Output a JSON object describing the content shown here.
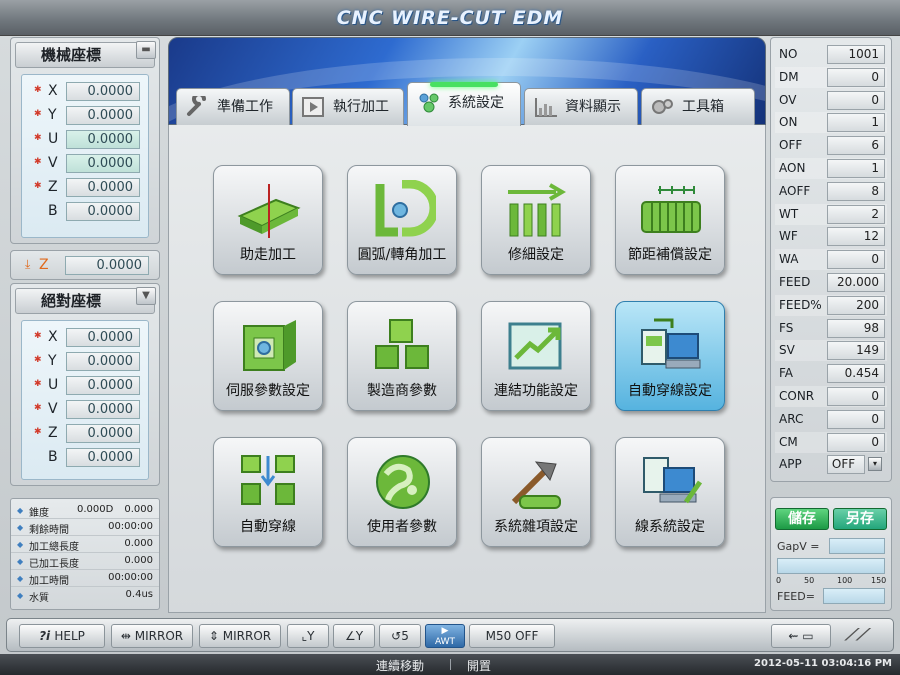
{
  "title": "CNC WIRE-CUT EDM",
  "machine_coords": {
    "title": "機械座標",
    "rows": [
      {
        "axis": "X",
        "value": "0.0000"
      },
      {
        "axis": "Y",
        "value": "0.0000"
      },
      {
        "axis": "U",
        "value": "0.0000"
      },
      {
        "axis": "V",
        "value": "0.0000"
      },
      {
        "axis": "Z",
        "value": "0.0000"
      },
      {
        "axis": "B",
        "value": "0.0000"
      }
    ]
  },
  "z_reading": {
    "label": "Z",
    "value": "0.0000"
  },
  "absolute_coords": {
    "title": "絕對座標",
    "rows": [
      {
        "axis": "X",
        "value": "0.0000"
      },
      {
        "axis": "Y",
        "value": "0.0000"
      },
      {
        "axis": "U",
        "value": "0.0000"
      },
      {
        "axis": "V",
        "value": "0.0000"
      },
      {
        "axis": "Z",
        "value": "0.0000"
      },
      {
        "axis": "B",
        "value": "0.0000"
      }
    ]
  },
  "status": [
    {
      "label": "錐度",
      "mid": "0.000D",
      "value": "0.000"
    },
    {
      "label": "剩餘時間",
      "mid": "",
      "value": "00:00:00"
    },
    {
      "label": "加工總長度",
      "mid": "",
      "value": "0.000"
    },
    {
      "label": "已加工長度",
      "mid": "",
      "value": "0.000"
    },
    {
      "label": "加工時間",
      "mid": "",
      "value": "00:00:00"
    },
    {
      "label": "水質",
      "mid": "",
      "value": "0.4us"
    }
  ],
  "tabs": [
    {
      "label": "準備工作",
      "icon": "wrench-icon"
    },
    {
      "label": "執行加工",
      "icon": "play-icon"
    },
    {
      "label": "系統設定",
      "icon": "system-settings-icon",
      "active": true
    },
    {
      "label": "資料顯示",
      "icon": "data-display-icon"
    },
    {
      "label": "工具箱",
      "icon": "toolbox-icon"
    }
  ],
  "tiles": [
    {
      "label": "助走加工",
      "icon": "approach-machining-icon"
    },
    {
      "label": "圓弧/轉角加工",
      "icon": "arc-corner-icon"
    },
    {
      "label": "修細設定",
      "icon": "trim-settings-icon"
    },
    {
      "label": "節距補償設定",
      "icon": "pitch-compensation-icon"
    },
    {
      "label": "伺服參數設定",
      "icon": "servo-parameter-icon"
    },
    {
      "label": "製造商參數",
      "icon": "manufacturer-parameter-icon"
    },
    {
      "label": "連結功能設定",
      "icon": "link-function-icon"
    },
    {
      "label": "自動穿線設定",
      "icon": "auto-threading-settings-icon",
      "selected": true
    },
    {
      "label": "自動穿線",
      "icon": "auto-threading-icon"
    },
    {
      "label": "使用者參數",
      "icon": "user-parameter-icon"
    },
    {
      "label": "系統雜項設定",
      "icon": "system-misc-icon"
    },
    {
      "label": "線系統設定",
      "icon": "wire-system-icon"
    }
  ],
  "params": [
    {
      "label": "NO",
      "value": "1001"
    },
    {
      "label": "DM",
      "value": "0"
    },
    {
      "label": "OV",
      "value": "0"
    },
    {
      "label": "ON",
      "value": "1"
    },
    {
      "label": "OFF",
      "value": "6"
    },
    {
      "label": "AON",
      "value": "1"
    },
    {
      "label": "AOFF",
      "value": "8"
    },
    {
      "label": "WT",
      "value": "2"
    },
    {
      "label": "WF",
      "value": "12"
    },
    {
      "label": "WA",
      "value": "0"
    },
    {
      "label": "FEED",
      "value": "20.000"
    },
    {
      "label": "FEED%",
      "value": "200"
    },
    {
      "label": "FS",
      "value": "98"
    },
    {
      "label": "SV",
      "value": "149"
    },
    {
      "label": "FA",
      "value": "0.454"
    },
    {
      "label": "CONR",
      "value": "0"
    },
    {
      "label": "ARC",
      "value": "0"
    },
    {
      "label": "CM",
      "value": "0"
    },
    {
      "label": "APP",
      "value": "OFF"
    }
  ],
  "save_label": "儲存",
  "save_as_label": "另存",
  "gapv_label": "GapV =",
  "gap_scale": [
    "0",
    "50",
    "100",
    "150"
  ],
  "feed_label": "FEED=",
  "toolbar": {
    "help": "HELP",
    "mirror_v": "MIRROR",
    "mirror_h": "MIRROR",
    "m50": "M50  OFF",
    "awt": "AWT"
  },
  "footer": {
    "mode1": "連續移動",
    "mode2": "開置",
    "datetime": "2012-05-11  03:04:16 PM"
  },
  "colors": {
    "accent_green": "#1c9a45",
    "selected_tile": "#56b3df",
    "star_red": "#d23b2b"
  }
}
